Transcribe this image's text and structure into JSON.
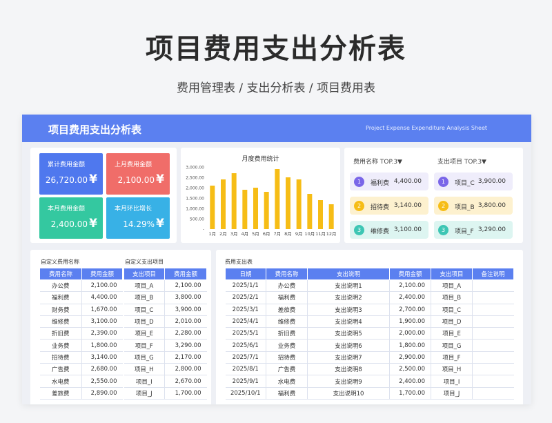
{
  "page": {
    "title": "项目费用支出分析表",
    "subtitle": "费用管理表 / 支出分析表 / 项目费用表"
  },
  "banner": {
    "title": "项目费用支出分析表",
    "subtitle_en": "Project Expense Expenditure Analysis Sheet"
  },
  "kpis": [
    {
      "label": "累计费用金额",
      "value": "26,720.00",
      "icon": "¥",
      "color": "#4f78ee"
    },
    {
      "label": "上月费用金额",
      "value": "2,100.00",
      "icon": "¥",
      "color": "#f06d69"
    },
    {
      "label": "本月费用金额",
      "value": "2,400.00",
      "icon": "¥",
      "color": "#34c8a0"
    },
    {
      "label": "本月环比增长",
      "value": "14.29%",
      "icon": "¥",
      "color": "#38b1e6"
    }
  ],
  "chart_data": {
    "type": "bar",
    "title": "月度费用统计",
    "categories": [
      "1月",
      "2月",
      "3月",
      "4月",
      "5月",
      "6月",
      "7月",
      "8月",
      "9月",
      "10月",
      "11月",
      "12月"
    ],
    "values": [
      2100,
      2400,
      2700,
      1900,
      2000,
      1800,
      2900,
      2500,
      2400,
      1700,
      1400,
      1200
    ],
    "ylim": [
      0,
      3000
    ],
    "yticks": [
      "-",
      "500.00",
      "1,000.00",
      "1,500.00",
      "2,000.00",
      "2,500.00",
      "3,000.00"
    ],
    "bar_color": "#f6bd16",
    "grid": false
  },
  "top3": {
    "fee_header": "费用名称  TOP.3▼",
    "project_header": "支出项目  TOP.3▼",
    "fee": [
      {
        "rank": "1",
        "name": "福利费",
        "value": "4,400.00"
      },
      {
        "rank": "2",
        "name": "招待费",
        "value": "3,140.00"
      },
      {
        "rank": "3",
        "name": "维修费",
        "value": "3,100.00"
      }
    ],
    "project": [
      {
        "rank": "1",
        "name": "项目_C",
        "value": "3,900.00"
      },
      {
        "rank": "2",
        "name": "项目_B",
        "value": "3,800.00"
      },
      {
        "rank": "3",
        "name": "项目_F",
        "value": "3,290.00"
      }
    ],
    "colors": {
      "1": {
        "badge": "#7a66e8",
        "bg": "#efedfb"
      },
      "2": {
        "badge": "#f6bd16",
        "bg": "#fdf1cf"
      },
      "3": {
        "badge": "#3dc6b4",
        "bg": "#ddf5f1"
      }
    }
  },
  "fee_table": {
    "caption": "自定义费用名称",
    "headers": [
      "费用名称",
      "费用金额"
    ],
    "rows": [
      [
        "办公费",
        "2,100.00"
      ],
      [
        "福利费",
        "4,400.00"
      ],
      [
        "财务费",
        "1,670.00"
      ],
      [
        "维修费",
        "3,100.00"
      ],
      [
        "折旧费",
        "2,390.00"
      ],
      [
        "业务费",
        "1,800.00"
      ],
      [
        "招待费",
        "3,140.00"
      ],
      [
        "广告费",
        "2,680.00"
      ],
      [
        "水电费",
        "2,550.00"
      ],
      [
        "差旅费",
        "2,890.00"
      ]
    ]
  },
  "project_table": {
    "caption": "自定义支出项目",
    "headers": [
      "支出项目",
      "费用金额"
    ],
    "rows": [
      [
        "项目_A",
        "2,100.00"
      ],
      [
        "项目_B",
        "3,800.00"
      ],
      [
        "项目_C",
        "3,900.00"
      ],
      [
        "项目_D",
        "2,010.00"
      ],
      [
        "项目_E",
        "2,280.00"
      ],
      [
        "项目_F",
        "3,290.00"
      ],
      [
        "项目_G",
        "2,170.00"
      ],
      [
        "项目_H",
        "2,800.00"
      ],
      [
        "项目_I",
        "2,670.00"
      ],
      [
        "项目_J",
        "1,700.00"
      ]
    ]
  },
  "expense_table": {
    "caption": "费用支出表",
    "headers": [
      "日期",
      "费用名称",
      "支出说明",
      "费用金额",
      "支出项目",
      "备注说明"
    ],
    "rows": [
      [
        "2025/1/1",
        "办公费",
        "支出说明1",
        "2,100.00",
        "项目_A",
        ""
      ],
      [
        "2025/2/1",
        "福利费",
        "支出说明2",
        "2,400.00",
        "项目_B",
        ""
      ],
      [
        "2025/3/1",
        "差旅费",
        "支出说明3",
        "2,700.00",
        "项目_C",
        ""
      ],
      [
        "2025/4/1",
        "维修费",
        "支出说明4",
        "1,900.00",
        "项目_D",
        ""
      ],
      [
        "2025/5/1",
        "折旧费",
        "支出说明5",
        "2,000.00",
        "项目_E",
        ""
      ],
      [
        "2025/6/1",
        "业务费",
        "支出说明6",
        "1,800.00",
        "项目_G",
        ""
      ],
      [
        "2025/7/1",
        "招待费",
        "支出说明7",
        "2,900.00",
        "项目_F",
        ""
      ],
      [
        "2025/8/1",
        "广告费",
        "支出说明8",
        "2,500.00",
        "项目_H",
        ""
      ],
      [
        "2025/9/1",
        "水电费",
        "支出说明9",
        "2,400.00",
        "项目_I",
        ""
      ],
      [
        "2025/10/1",
        "福利费",
        "支出说明10",
        "1,700.00",
        "项目_J",
        ""
      ]
    ]
  }
}
